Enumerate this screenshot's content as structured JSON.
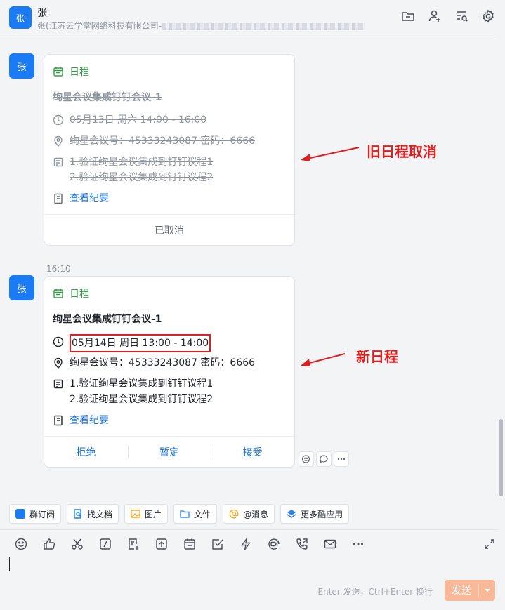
{
  "header": {
    "avatar_text": "张",
    "name": "张",
    "subtitle": "张",
    "subtitle_org": "(江苏云学堂网络科技有限公司-"
  },
  "messages": [
    {
      "avatar_text": "张",
      "card_type": "日程",
      "title": "绚星会议集成钉钉会议-1",
      "time": "05月13日 周六 14:00 - 16:00",
      "location": "绚星会议号：45333243087 密码：6666",
      "agenda": [
        "1.验证绚星会议集成到钉钉议程1",
        "2.验证绚星会议集成到钉钉议程2"
      ],
      "minutes_link": "查看纪要",
      "status": "已取消",
      "annotation": "旧日程取消"
    },
    {
      "timestamp": "16:10",
      "avatar_text": "张",
      "card_type": "日程",
      "title": "绚星会议集成钉钉会议-1",
      "time": "05月14日 周日 13:00 - 14:00",
      "location": "绚星会议号：45333243087 密码：6666",
      "agenda": [
        "1.验证绚星会议集成到钉钉议程1",
        "2.验证绚星会议集成到钉钉议程2"
      ],
      "minutes_link": "查看纪要",
      "buttons": [
        "拒绝",
        "暂定",
        "接受"
      ],
      "annotation": "新日程"
    }
  ],
  "quickbar": [
    {
      "label": "群订阅",
      "color": "#1a7bf5"
    },
    {
      "label": "找文档",
      "color": "#1a7bf5"
    },
    {
      "label": "图片",
      "color": "#f5a623"
    },
    {
      "label": "文件",
      "color": "#3d8df5"
    },
    {
      "label": "@消息",
      "color": "#f5a623"
    },
    {
      "label": "更多酷应用",
      "color": "#2b7de9"
    }
  ],
  "composer": {
    "hint": "Enter 发送，Ctrl+Enter 换行",
    "send_label": "发送"
  },
  "colors": {
    "accent": "#1a7bf5",
    "schedule_green": "#2ea043",
    "annotation_red": "#e02020",
    "send_button": "#f9b999"
  }
}
